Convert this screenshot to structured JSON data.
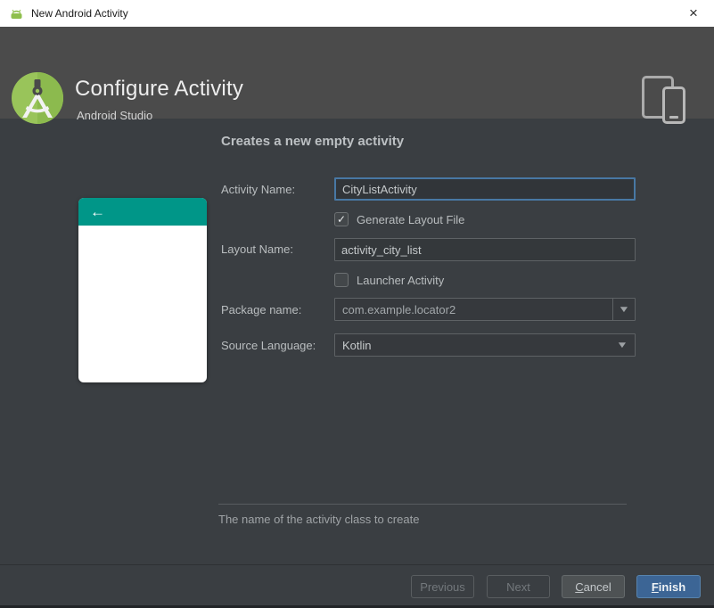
{
  "window": {
    "title": "New Android Activity"
  },
  "header": {
    "title": "Configure Activity",
    "subtitle": "Android Studio"
  },
  "content": {
    "heading": "Creates a new empty activity",
    "fields": {
      "activity_name": {
        "label": "Activity Name:",
        "value": "CityListActivity"
      },
      "generate_layout": {
        "label": "Generate Layout File",
        "checked": true
      },
      "layout_name": {
        "label": "Layout Name:",
        "value": "activity_city_list"
      },
      "launcher_activity": {
        "label": "Launcher Activity",
        "checked": false
      },
      "package_name": {
        "label": "Package name:",
        "value": "com.example.locator2"
      },
      "source_language": {
        "label": "Source Language:",
        "value": "Kotlin"
      }
    },
    "hint": "The name of the activity class to create"
  },
  "footer": {
    "previous_label": "Previous",
    "next_label": "Next",
    "cancel": {
      "underlined": "C",
      "rest": "ancel"
    },
    "finish": {
      "underlined": "F",
      "rest": "inish"
    }
  },
  "icons": {
    "close": "×",
    "back_arrow": "←",
    "dropdown_arrow": "▼",
    "check": "✓"
  },
  "colors": {
    "titlebar_bg": "#ffffff",
    "banner_bg": "#4b4b4b",
    "content_bg": "#3a3e42",
    "appbar_teal": "#009688",
    "focus_blue": "#4878a4",
    "finish_blue": "#3c6595",
    "logo_green": "#99c45a"
  }
}
